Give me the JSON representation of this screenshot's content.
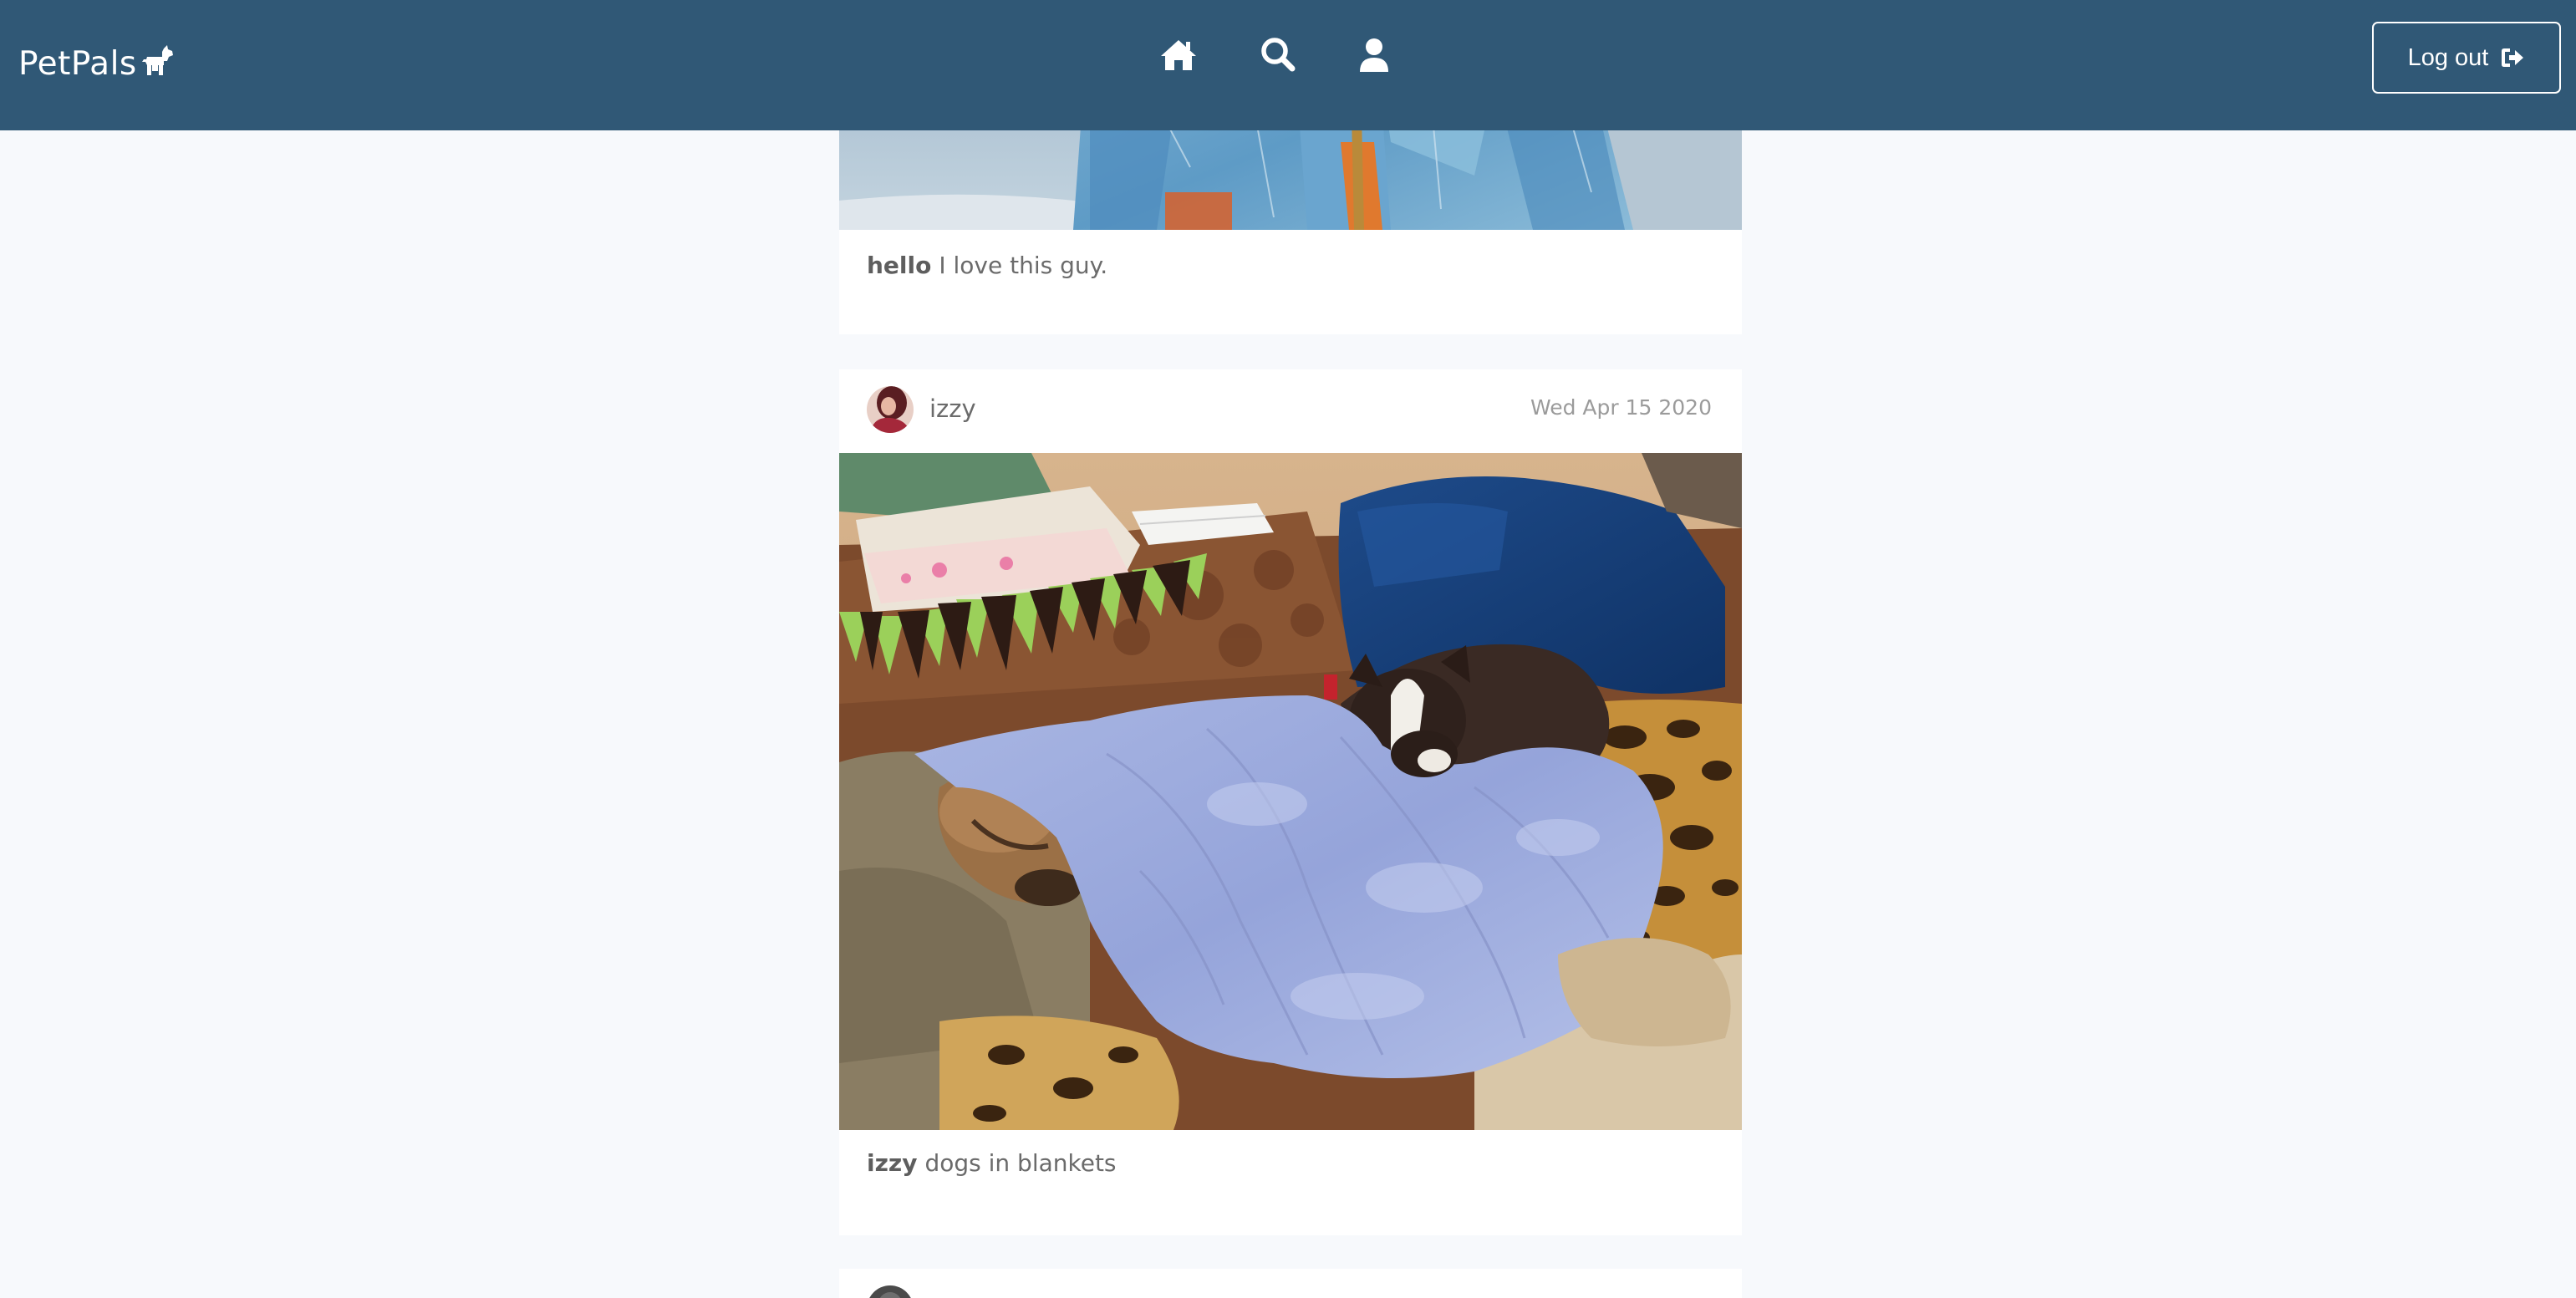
{
  "app": {
    "brand": "PetPals"
  },
  "nav": {
    "icons": [
      "home-icon",
      "search-icon",
      "user-icon"
    ],
    "logout_label": "Log out",
    "logout_icon": "sign-out-icon"
  },
  "posts": [
    {
      "caption_user": "hello",
      "caption_text": "I love this guy."
    },
    {
      "username": "izzy",
      "date": "Wed Apr 15 2020",
      "caption_user": "izzy",
      "caption_text": "dogs in blankets"
    }
  ],
  "colors": {
    "navbar": "#305876",
    "page_background": "#f7f9fc",
    "card_background": "#ffffff"
  }
}
